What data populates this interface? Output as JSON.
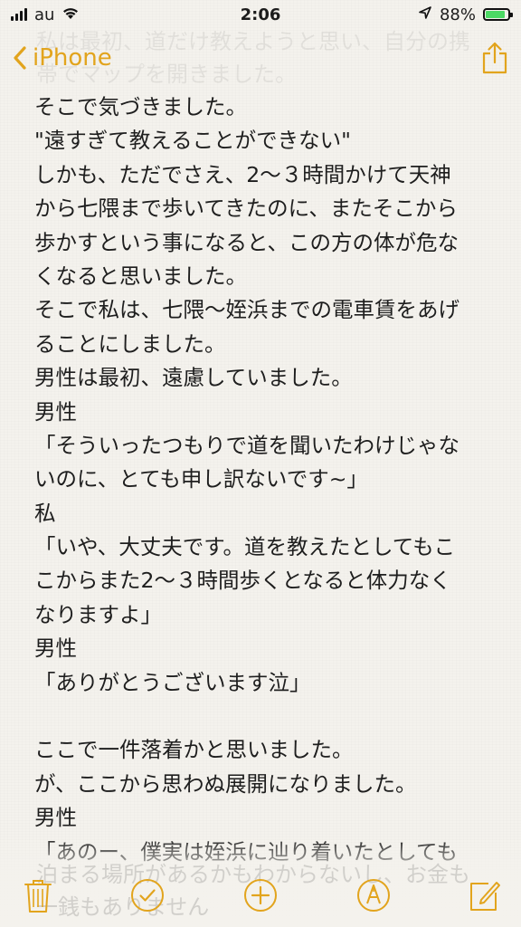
{
  "status_bar": {
    "carrier": "au",
    "time": "2:06",
    "battery_percent": "88%",
    "battery_level": 0.88,
    "colors": {
      "battery_fill": "#4cd964"
    }
  },
  "nav": {
    "back_label": "iPhone",
    "accent_color": "#e2a41d",
    "icons": {
      "back": "chevron-left-icon",
      "share": "share-icon"
    }
  },
  "ghost_top_lines": [
    "私は最初、道だけ教えようと思い、自分の携",
    "帯でマップを開きました。"
  ],
  "note_lines": [
    "そこで気づきました。",
    "\"遠すぎて教えることができない\"",
    "しかも、ただでさえ、2〜３時間かけて天神",
    "から七隈まで歩いてきたのに、またそこから",
    "歩かすという事になると、この方の体が危な",
    "くなると思いました。",
    "そこで私は、七隈〜姪浜までの電車賃をあげ",
    "ることにしました。",
    "男性は最初、遠慮していました。",
    "男性",
    "「そういったつもりで道を聞いたわけじゃな",
    "いのに、とても申し訳ないです~」",
    "私",
    "「いや、大丈夫です。道を教えたとしてもこ",
    "こからまた2〜３時間歩くとなると体力なく",
    "なりますよ」",
    "男性",
    "「ありがとうございます泣」",
    "",
    "ここで一件落着かと思いました。",
    "が、ここから思わぬ展開になりました。",
    "男性",
    "「あのー、僕実は姪浜に辿り着いたとしても"
  ],
  "ghost_bottom_lines": [
    "泊まる場所があるかもわからないし、お金も",
    "一銭もありません"
  ],
  "toolbar": {
    "icons": [
      "trash-icon",
      "checklist-icon",
      "add-icon",
      "markup-icon",
      "compose-icon"
    ]
  }
}
